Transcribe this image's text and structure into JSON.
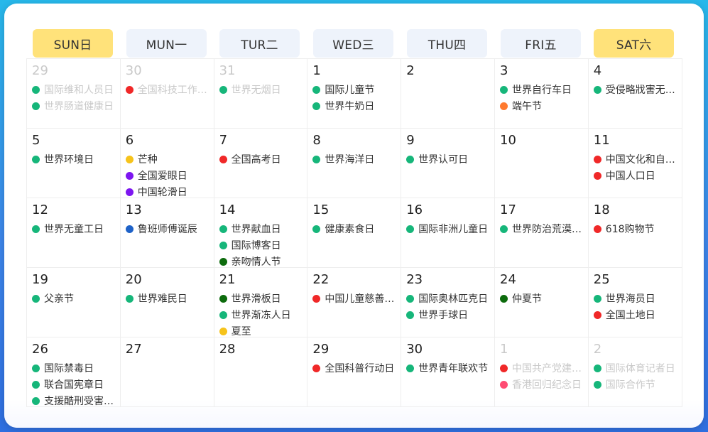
{
  "weekdays": [
    {
      "label": "SUN日",
      "weekend": true
    },
    {
      "label": "MUN一",
      "weekend": false
    },
    {
      "label": "TUR二",
      "weekend": false
    },
    {
      "label": "WED三",
      "weekend": false
    },
    {
      "label": "THU四",
      "weekend": false
    },
    {
      "label": "FRI五",
      "weekend": false
    },
    {
      "label": "SAT六",
      "weekend": true
    }
  ],
  "colors": {
    "green": "#16b67a",
    "red": "#f02828",
    "yellow": "#f6c31b",
    "purple": "#7d16f0",
    "blue": "#1e62c8",
    "darkgreen": "#0d6b0d",
    "orange": "#ff7a2f",
    "pink": "#ff4b73"
  },
  "weeks": [
    [
      {
        "day": "29",
        "dim": true,
        "events": [
          {
            "text": "国际维和人员日",
            "color": "green"
          },
          {
            "text": "世界肠道健康日",
            "color": "green"
          }
        ]
      },
      {
        "day": "30",
        "dim": true,
        "events": [
          {
            "text": "全国科技工作者日",
            "color": "red"
          }
        ]
      },
      {
        "day": "31",
        "dim": true,
        "events": [
          {
            "text": "世界无烟日",
            "color": "green"
          }
        ]
      },
      {
        "day": "1",
        "dim": false,
        "events": [
          {
            "text": "国际儿童节",
            "color": "green"
          },
          {
            "text": "世界牛奶日",
            "color": "green"
          }
        ]
      },
      {
        "day": "2",
        "dim": false,
        "events": []
      },
      {
        "day": "3",
        "dim": false,
        "events": [
          {
            "text": "世界自行车日",
            "color": "green"
          },
          {
            "text": "端午节",
            "color": "orange"
          }
        ]
      },
      {
        "day": "4",
        "dim": false,
        "events": [
          {
            "text": "受侵略戕害无辜儿童国际日",
            "color": "green"
          }
        ]
      }
    ],
    [
      {
        "day": "5",
        "dim": false,
        "events": [
          {
            "text": "世界环境日",
            "color": "green"
          }
        ]
      },
      {
        "day": "6",
        "dim": false,
        "events": [
          {
            "text": "芒种",
            "color": "yellow"
          },
          {
            "text": "全国爱眼日",
            "color": "purple"
          },
          {
            "text": "中国轮滑日",
            "color": "purple"
          }
        ]
      },
      {
        "day": "7",
        "dim": false,
        "events": [
          {
            "text": "全国高考日",
            "color": "red"
          }
        ]
      },
      {
        "day": "8",
        "dim": false,
        "events": [
          {
            "text": "世界海洋日",
            "color": "green"
          }
        ]
      },
      {
        "day": "9",
        "dim": false,
        "events": [
          {
            "text": "世界认可日",
            "color": "green"
          }
        ]
      },
      {
        "day": "10",
        "dim": false,
        "events": []
      },
      {
        "day": "11",
        "dim": false,
        "events": [
          {
            "text": "中国文化和自然遗产日",
            "color": "red"
          },
          {
            "text": "中国人口日",
            "color": "red"
          }
        ]
      }
    ],
    [
      {
        "day": "12",
        "dim": false,
        "events": [
          {
            "text": "世界无童工日",
            "color": "green"
          }
        ]
      },
      {
        "day": "13",
        "dim": false,
        "events": [
          {
            "text": "鲁班师傅诞辰",
            "color": "blue"
          }
        ]
      },
      {
        "day": "14",
        "dim": false,
        "events": [
          {
            "text": "世界献血日",
            "color": "green"
          },
          {
            "text": "国际博客日",
            "color": "green"
          },
          {
            "text": "亲吻情人节",
            "color": "darkgreen"
          }
        ]
      },
      {
        "day": "15",
        "dim": false,
        "events": [
          {
            "text": "健康素食日",
            "color": "green"
          }
        ]
      },
      {
        "day": "16",
        "dim": false,
        "events": [
          {
            "text": "国际非洲儿童日",
            "color": "green"
          }
        ]
      },
      {
        "day": "17",
        "dim": false,
        "events": [
          {
            "text": "世界防治荒漠化和干旱日",
            "color": "green"
          }
        ]
      },
      {
        "day": "18",
        "dim": false,
        "events": [
          {
            "text": "618购物节",
            "color": "red"
          }
        ]
      }
    ],
    [
      {
        "day": "19",
        "dim": false,
        "events": [
          {
            "text": "父亲节",
            "color": "green"
          }
        ]
      },
      {
        "day": "20",
        "dim": false,
        "events": [
          {
            "text": "世界难民日",
            "color": "green"
          }
        ]
      },
      {
        "day": "21",
        "dim": false,
        "events": [
          {
            "text": "世界滑板日",
            "color": "darkgreen"
          },
          {
            "text": "世界渐冻人日",
            "color": "green"
          },
          {
            "text": "夏至",
            "color": "yellow"
          }
        ]
      },
      {
        "day": "22",
        "dim": false,
        "events": [
          {
            "text": "中国儿童慈善活动日",
            "color": "red"
          }
        ]
      },
      {
        "day": "23",
        "dim": false,
        "events": [
          {
            "text": "国际奥林匹克日",
            "color": "green"
          },
          {
            "text": "世界手球日",
            "color": "green"
          }
        ]
      },
      {
        "day": "24",
        "dim": false,
        "events": [
          {
            "text": "仲夏节",
            "color": "darkgreen"
          }
        ]
      },
      {
        "day": "25",
        "dim": false,
        "events": [
          {
            "text": "世界海员日",
            "color": "green"
          },
          {
            "text": "全国土地日",
            "color": "red"
          }
        ]
      }
    ],
    [
      {
        "day": "26",
        "dim": false,
        "events": [
          {
            "text": "国际禁毒日",
            "color": "green"
          },
          {
            "text": "联合国宪章日",
            "color": "green"
          },
          {
            "text": "支援酷刑受害者国际日",
            "color": "green"
          }
        ]
      },
      {
        "day": "27",
        "dim": false,
        "events": []
      },
      {
        "day": "28",
        "dim": false,
        "events": []
      },
      {
        "day": "29",
        "dim": false,
        "events": [
          {
            "text": "全国科普行动日",
            "color": "red"
          }
        ]
      },
      {
        "day": "30",
        "dim": false,
        "events": [
          {
            "text": "世界青年联欢节",
            "color": "green"
          }
        ]
      },
      {
        "day": "1",
        "dim": true,
        "events": [
          {
            "text": "中国共产党建党纪念日",
            "color": "red"
          },
          {
            "text": "香港回归纪念日",
            "color": "pink"
          }
        ]
      },
      {
        "day": "2",
        "dim": true,
        "events": [
          {
            "text": "国际体育记者日",
            "color": "green"
          },
          {
            "text": "国际合作节",
            "color": "green"
          }
        ]
      }
    ]
  ]
}
